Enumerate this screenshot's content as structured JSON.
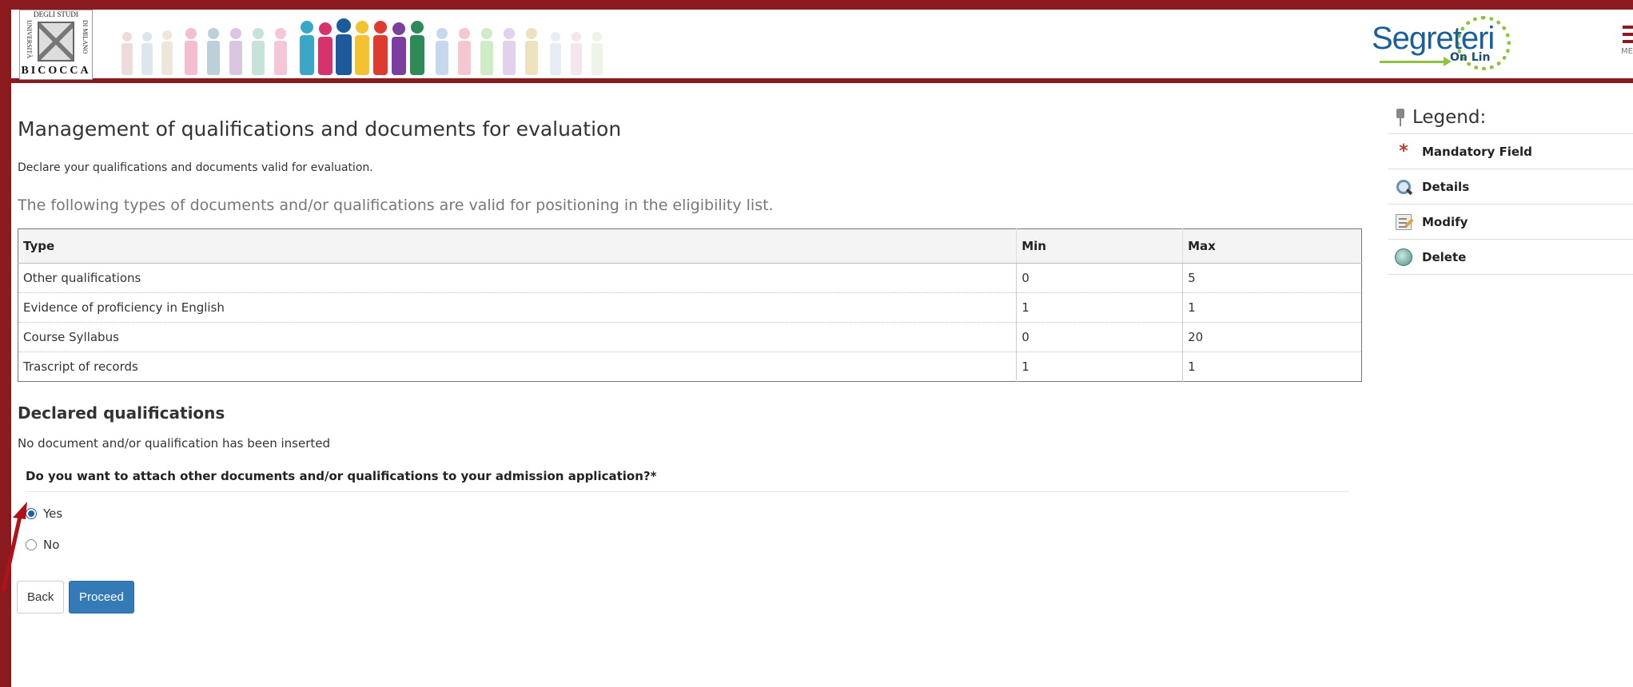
{
  "header": {
    "logo": {
      "top_text": "DEGLI STUDI",
      "left_text": "UNIVERSITÀ",
      "right_text": "DI MILANO",
      "bottom_text": "BICOCCA"
    },
    "brand": {
      "main": "Segreteri",
      "sub": "On Lin"
    },
    "menu_label": "MEN"
  },
  "main": {
    "title": "Management of qualifications and documents for evaluation",
    "description": "Declare your qualifications and documents valid for evaluation.",
    "types_intro": "The following types of documents and/or qualifications are valid for positioning in the eligibility list.",
    "table": {
      "headers": {
        "type": "Type",
        "min": "Min",
        "max": "Max"
      },
      "rows": [
        {
          "type": "Other qualifications",
          "min": "0",
          "max": "5"
        },
        {
          "type": "Evidence of proficiency in English",
          "min": "1",
          "max": "1"
        },
        {
          "type": "Course Syllabus",
          "min": "0",
          "max": "20"
        },
        {
          "type": "Trascript of records",
          "min": "1",
          "max": "1"
        }
      ]
    },
    "declared_title": "Declared qualifications",
    "declared_empty": "No document and/or qualification has been inserted",
    "question": "Do you want to attach other documents and/or qualifications to your admission application?*",
    "options": {
      "yes": "Yes",
      "no": "No",
      "selected": "Yes"
    },
    "buttons": {
      "back": "Back",
      "proceed": "Proceed"
    }
  },
  "legend": {
    "title": "Legend:",
    "items": [
      {
        "label": "Mandatory Field",
        "icon": "asterisk-icon"
      },
      {
        "label": "Details",
        "icon": "magnifier-icon"
      },
      {
        "label": "Modify",
        "icon": "edit-icon"
      },
      {
        "label": "Delete",
        "icon": "trash-icon"
      }
    ]
  },
  "colors": {
    "frame": "#8b1a1e",
    "primary_button": "#337ab7",
    "brand_blue": "#1a5f99",
    "brand_green": "#8fc13e",
    "mandatory_star": "#c0392b"
  }
}
